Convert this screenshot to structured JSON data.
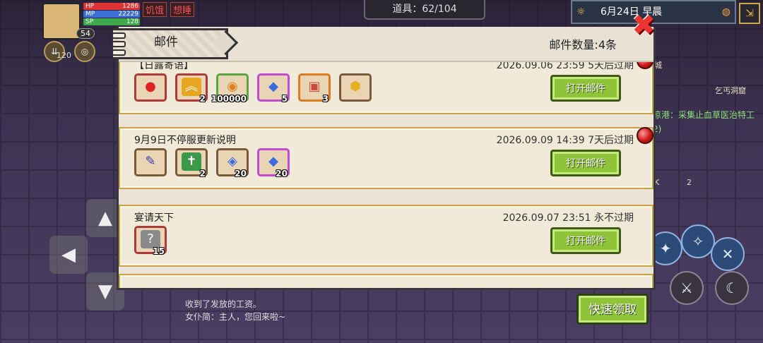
{
  "hud": {
    "hp_label": "HP",
    "hp_value": "1286",
    "mp_label": "MP",
    "mp_value": "22229",
    "sp_label": "SP",
    "sp_value": "128",
    "level": "54",
    "status_hunger": "饥饿",
    "status_sleepy": "想睡",
    "buff_count": "120",
    "items_counter": "道具：62/104",
    "date": "6月24日",
    "time_of_day": "早晨",
    "map_label_right": "乞丐洞窟",
    "map_label_city": "城",
    "quest_text": "凉港：采集止血草医治特工",
    "quest_progress": "2)",
    "right_slot_label": "K",
    "right_slot_qty": "2"
  },
  "dialog": {
    "title": "邮件",
    "count_label": "邮件数量:4条",
    "close_icon": "close-icon"
  },
  "mails": [
    {
      "name": "【日露寄语】",
      "date": "2026.09.06 23:59",
      "expiry": "5天后过期",
      "unread": true,
      "open_label": "打开邮件",
      "attachments": [
        {
          "icon": "apple-icon",
          "qty": ""
        },
        {
          "icon": "rank-up-icon",
          "qty": "2"
        },
        {
          "icon": "coin-icon",
          "qty": "100000"
        },
        {
          "icon": "diamond-icon",
          "qty": "5"
        },
        {
          "icon": "gem-icon",
          "qty": "3"
        },
        {
          "icon": "gold-badge-icon",
          "qty": ""
        }
      ]
    },
    {
      "name": "9月9日不停服更新说明",
      "date": "2026.09.09 14:39",
      "expiry": "7天后过期",
      "unread": true,
      "open_label": "打开邮件",
      "attachments": [
        {
          "icon": "staff-icon",
          "qty": ""
        },
        {
          "icon": "book-icon",
          "qty": "2"
        },
        {
          "icon": "crystal-icon",
          "qty": "20"
        },
        {
          "icon": "diamond-icon",
          "qty": "20"
        }
      ]
    },
    {
      "name": "宴请天下",
      "date": "2026.09.07 23:51",
      "expiry": "永不过期",
      "unread": false,
      "open_label": "打开邮件",
      "attachments": [
        {
          "icon": "mystery-box-icon",
          "qty": "15"
        }
      ]
    }
  ],
  "quick_claim_label": "快速领取",
  "chat": {
    "line1": "收到了发放的工资。",
    "line2": "女仆简：主人，您回来啦~"
  }
}
